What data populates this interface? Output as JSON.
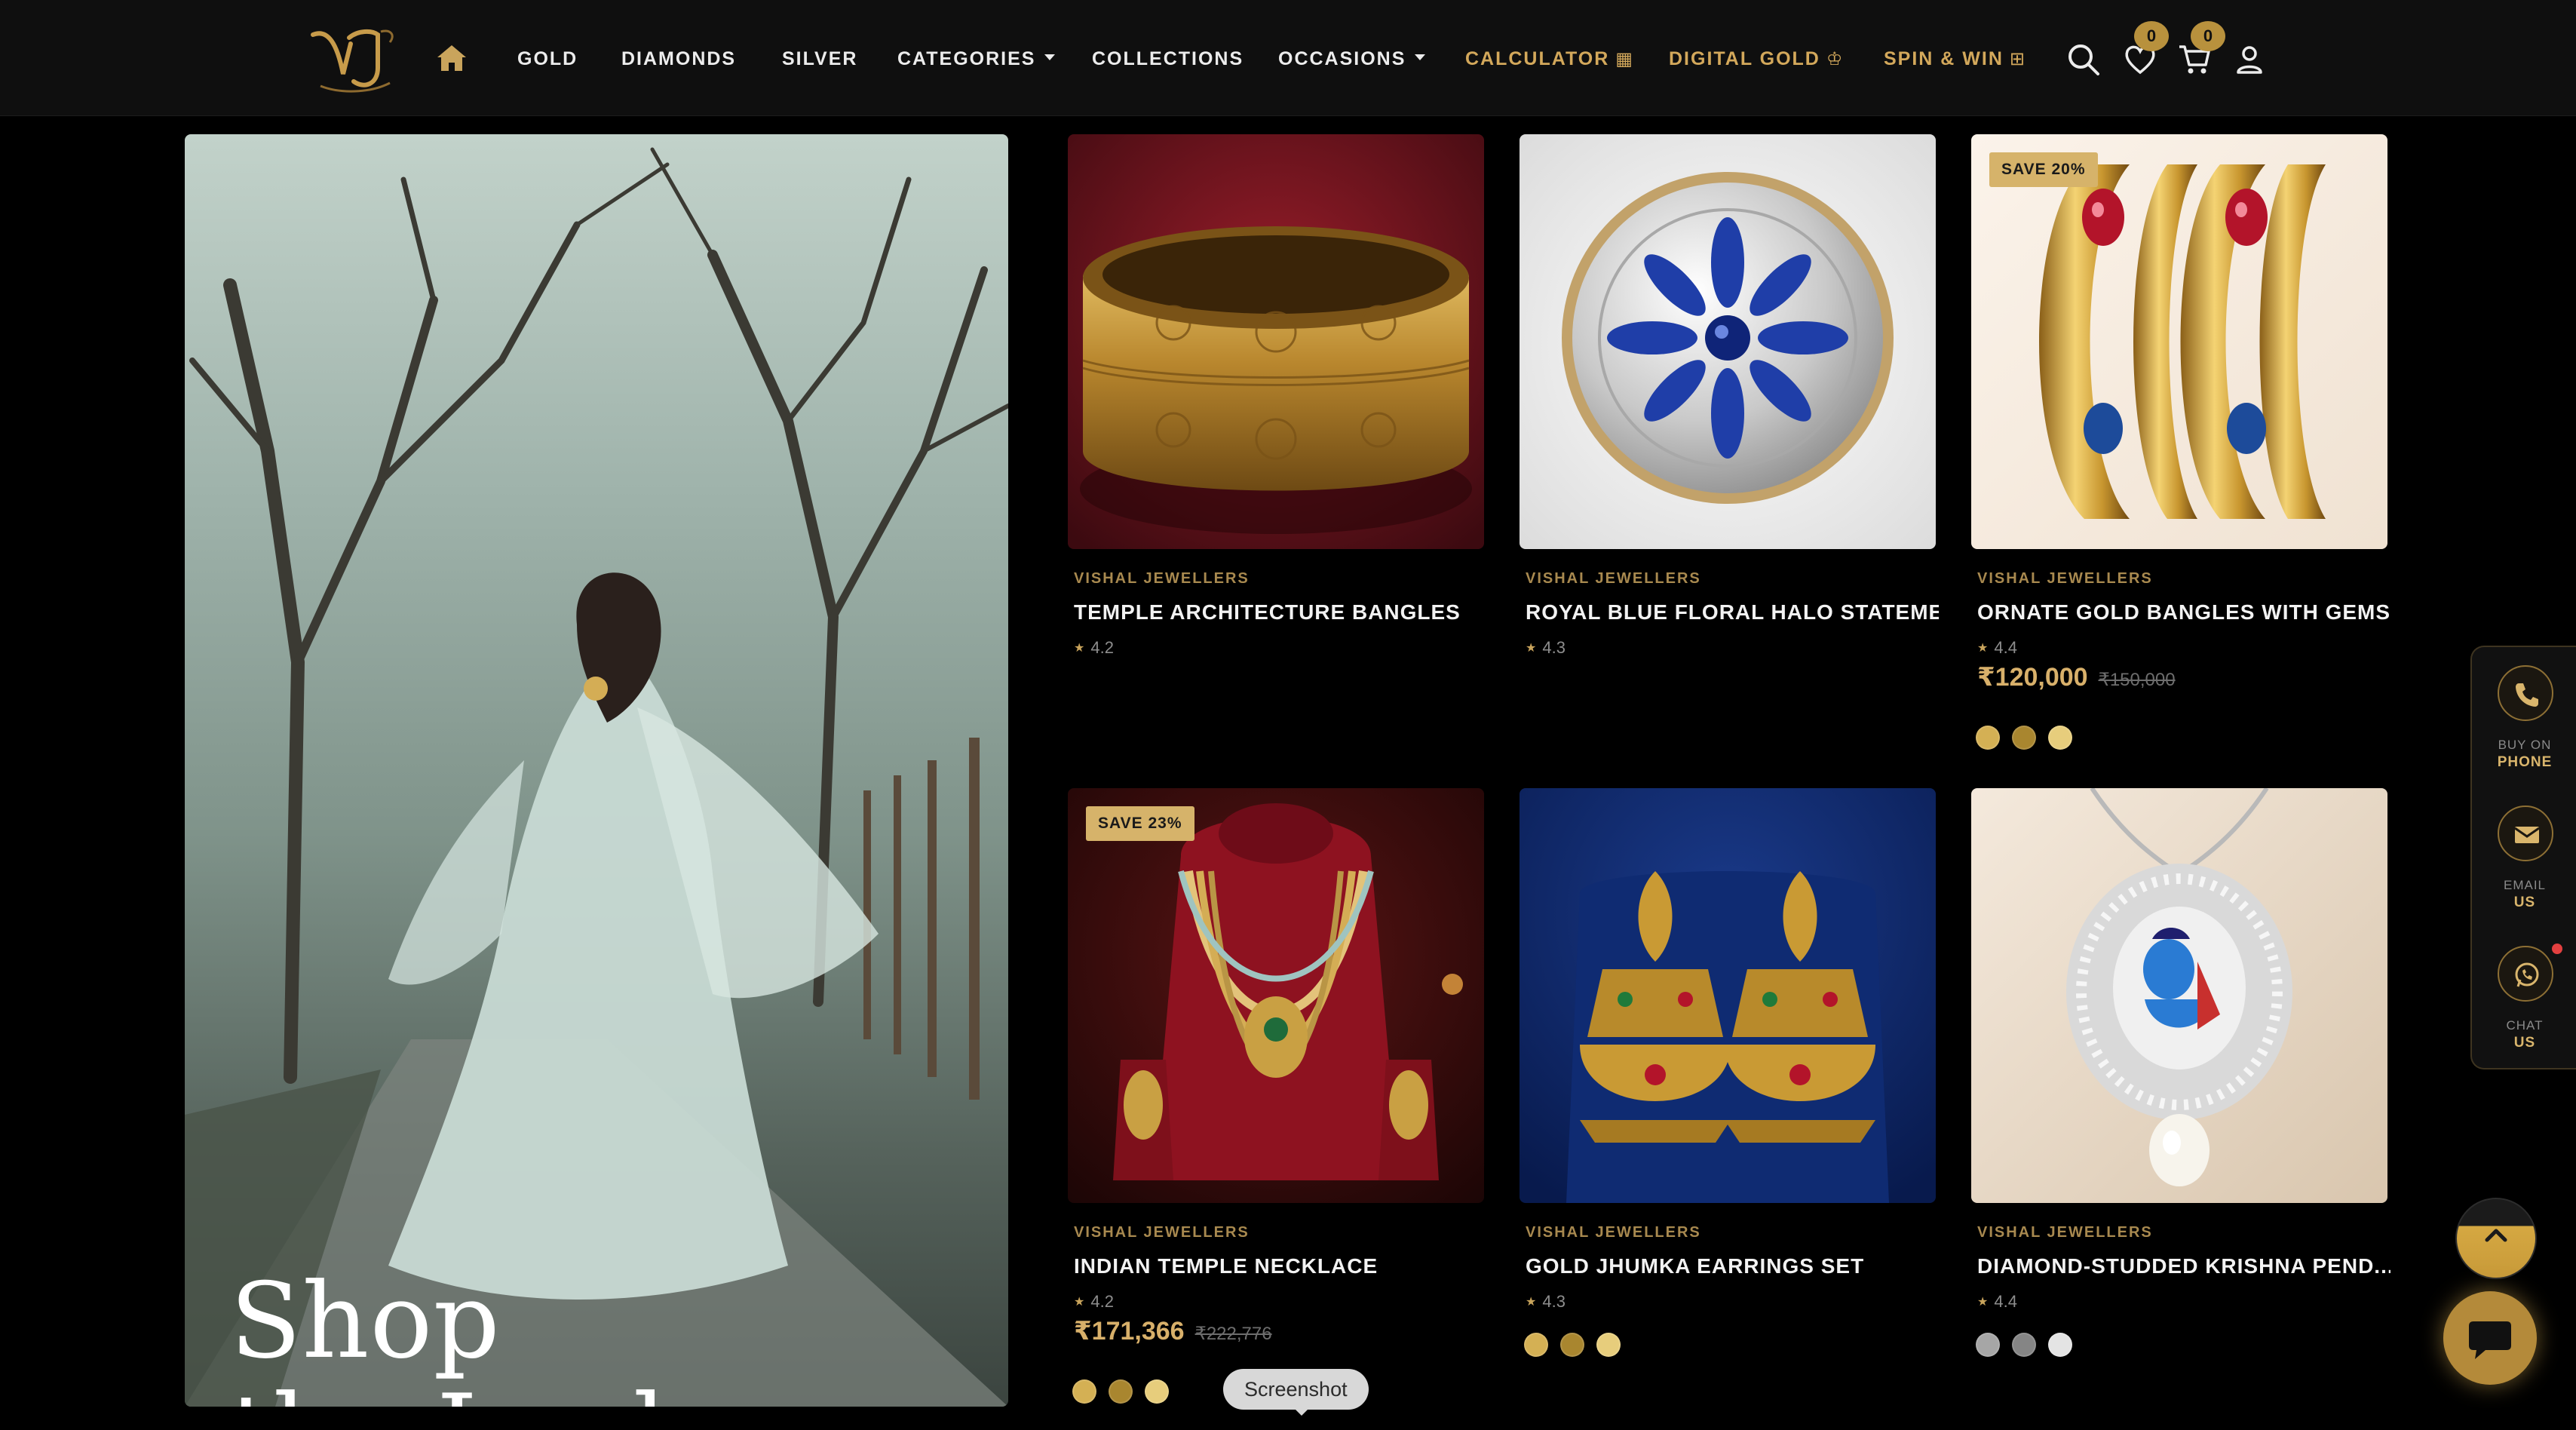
{
  "nav": {
    "logo_text": "VJ",
    "items": [
      {
        "label": "GOLD"
      },
      {
        "label": "DIAMONDS"
      },
      {
        "label": "SILVER"
      },
      {
        "label": "CATEGORIES"
      },
      {
        "label": "COLLECTIONS"
      },
      {
        "label": "OCCASIONS"
      },
      {
        "label": "CALCULATOR"
      },
      {
        "label": "DIGITAL GOLD"
      },
      {
        "label": "SPIN & WIN"
      }
    ],
    "wishlist_count": "0",
    "cart_count": "0",
    "icons": [
      "home-icon",
      "calculator-icon",
      "crown-icon",
      "gift-icon",
      "search-icon",
      "heart-icon",
      "cart-icon",
      "user-icon"
    ]
  },
  "hero": {
    "title_line1": "Shop",
    "title_line2": "the Look"
  },
  "products": [
    {
      "brand": "VISHAL JEWELLERS",
      "name": "TEMPLE ARCHITECTURE BANGLES",
      "rating": "4.2",
      "badge": "",
      "price": "",
      "old_price": "",
      "swatches": [
        "#d4b054",
        "#a9862f",
        "#e7cd7c"
      ]
    },
    {
      "brand": "VISHAL JEWELLERS",
      "name": "ROYAL BLUE FLORAL HALO STATEME...",
      "rating": "4.3",
      "badge": "",
      "price": "",
      "old_price": "",
      "swatches": [
        "#a6a6a6",
        "#858585",
        "#e4e4e4"
      ]
    },
    {
      "brand": "VISHAL JEWELLERS",
      "name": "ORNATE GOLD BANGLES WITH GEMS...",
      "rating": "4.4",
      "badge": "SAVE 20%",
      "price": "₹120,000",
      "old_price": "₹150,000",
      "swatches": [
        "#d4b054",
        "#a9862f",
        "#e7cd7c"
      ]
    },
    {
      "brand": "VISHAL JEWELLERS",
      "name": "INDIAN TEMPLE NECKLACE",
      "rating": "4.2",
      "badge": "SAVE 23%",
      "price": "₹171,366",
      "old_price": "₹222,776",
      "swatches": [
        "#d4b054",
        "#a9862f",
        "#e7cd7c"
      ]
    },
    {
      "brand": "VISHAL JEWELLERS",
      "name": "GOLD JHUMKA EARRINGS SET",
      "rating": "4.3",
      "badge": "",
      "price": "",
      "old_price": "",
      "swatches": [
        "#d4b054",
        "#a9862f",
        "#e7cd7c"
      ]
    },
    {
      "brand": "VISHAL JEWELLERS",
      "name": "DIAMOND-STUDDED KRISHNA PEND...",
      "rating": "4.4",
      "badge": "",
      "price": "",
      "old_price": "",
      "swatches": [
        "#a6a6a6",
        "#858585",
        "#e4e4e4"
      ]
    }
  ],
  "contact": {
    "phone": {
      "line1": "BUY ON",
      "line2": "PHONE"
    },
    "email": {
      "line1": "EMAIL",
      "line2": "US"
    },
    "chat": {
      "line1": "CHAT",
      "line2": "US"
    }
  },
  "tooltip": "Screenshot",
  "colors": {
    "accent": "#c9a45c",
    "background": "#000000",
    "navbar": "#0f0f0f"
  }
}
